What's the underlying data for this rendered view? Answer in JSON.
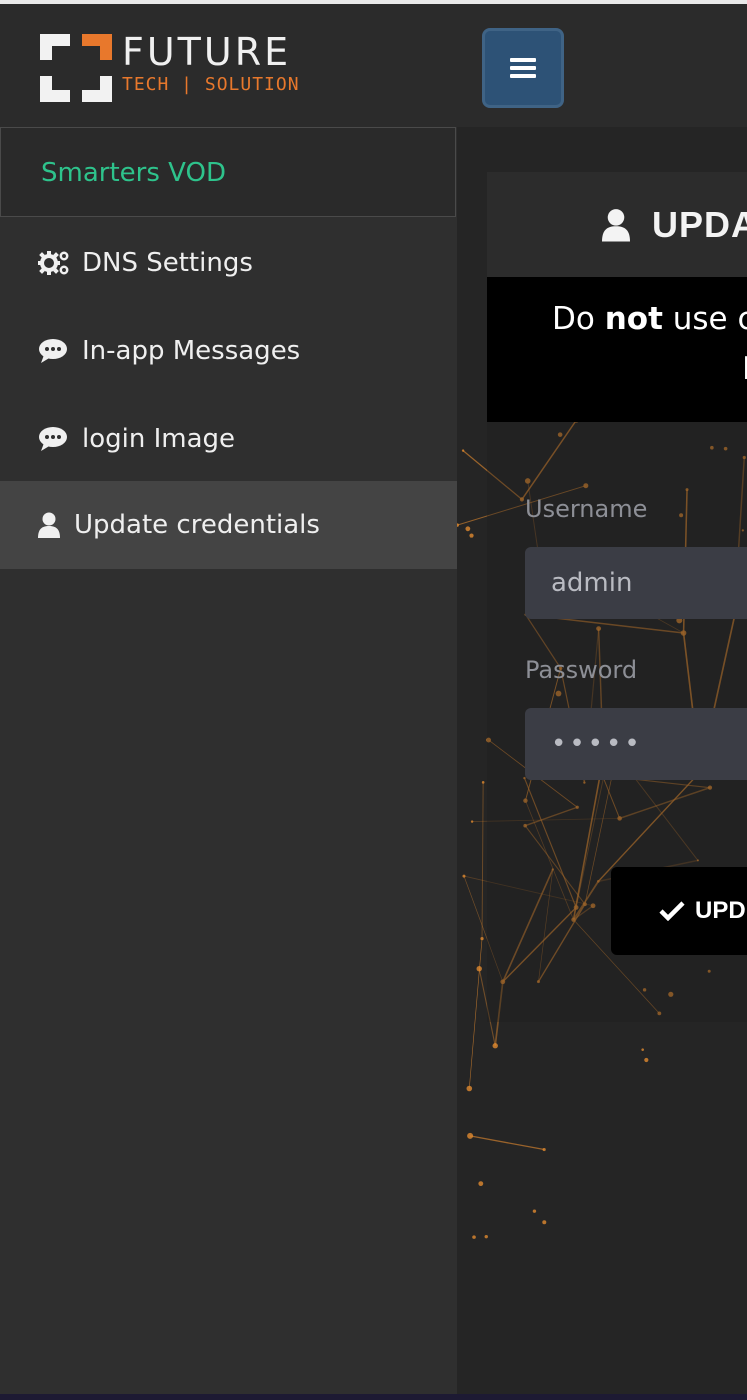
{
  "logo": {
    "line1": "FUTURE",
    "line2": "TECH | SOLUTION"
  },
  "navbar": {
    "menu_icon": "hamburger-icon"
  },
  "sidebar": {
    "brand": "Smarters VOD",
    "items": [
      {
        "label": "DNS Settings",
        "icon": "cogs-icon"
      },
      {
        "label": "In-app Messages",
        "icon": "comment-icon"
      },
      {
        "label": "login Image",
        "icon": "comment-icon"
      },
      {
        "label": "Update credentials",
        "icon": "user-icon",
        "active": true
      }
    ]
  },
  "card": {
    "title": "UPDA",
    "notice_line1_pre": "Do ",
    "notice_line1_bold": "not",
    "notice_line1_post": " use c",
    "notice_line2": "I",
    "username_label": "Username",
    "username_value": "admin",
    "password_label": "Password",
    "password_value": "•••••",
    "submit_label": "UPD"
  },
  "colors": {
    "brand_green": "#2ec38c",
    "menu_button": "#2d5276",
    "logo_orange": "#e8782c",
    "network_lines": "#e0892f"
  }
}
